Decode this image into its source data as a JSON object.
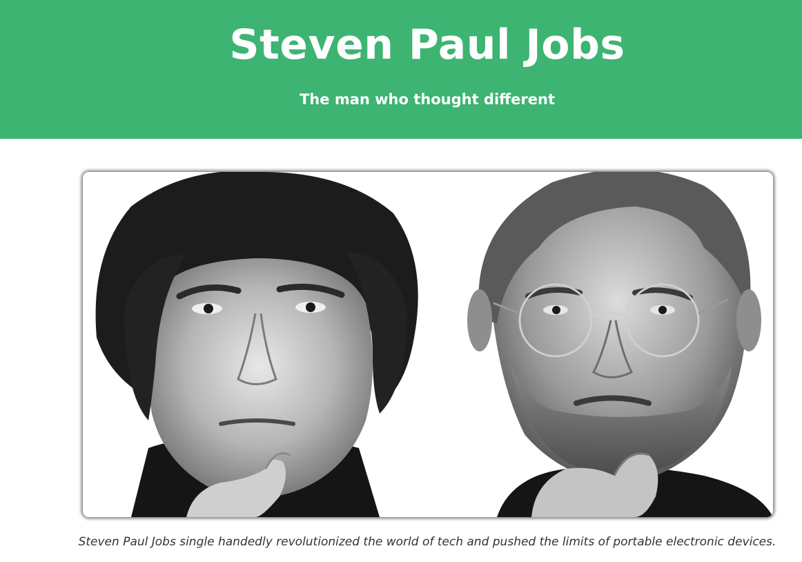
{
  "header": {
    "title": "Steven Paul Jobs",
    "subtitle": "The man who thought different",
    "background_color": "#3db472",
    "text_color": "#ffffff"
  },
  "main": {
    "image": {
      "semantic": "portrait-photo",
      "style": "black-and-white"
    },
    "caption": "Steven Paul Jobs single handedly revolutionized the world of tech and pushed the limits of portable electronic devices."
  }
}
